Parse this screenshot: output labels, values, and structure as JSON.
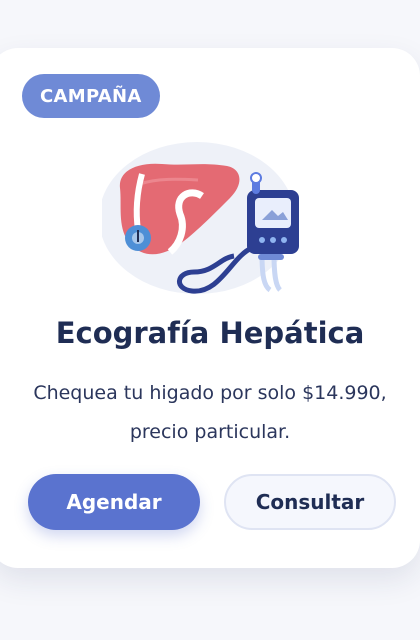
{
  "card": {
    "badge": "CAMPAÑA",
    "title": "Ecografía Hepática",
    "description": "Chequea tu higado por solo $14.990, precio particular.",
    "illustration_icon": "liver-ultrasound-icon",
    "buttons": {
      "primary_label": "Agendar",
      "secondary_label": "Consultar"
    }
  },
  "colors": {
    "badge": "#6f8ad6",
    "primary": "#5a73cf",
    "title": "#1f2d54",
    "liver": "#e46a73",
    "device": "#2d3f92"
  }
}
